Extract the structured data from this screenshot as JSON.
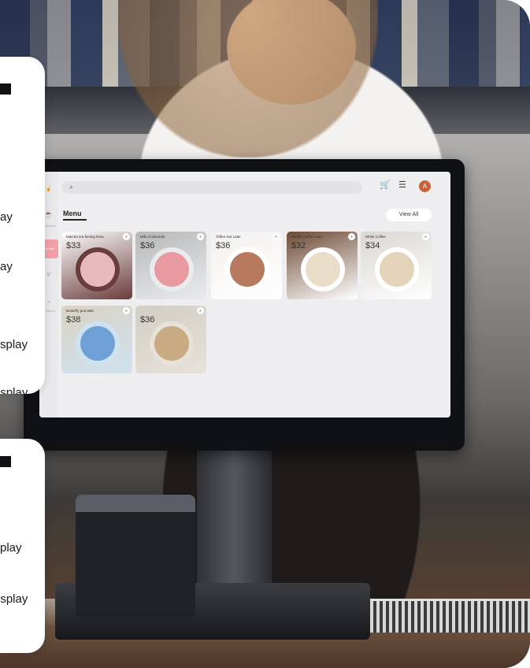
{
  "pos_app": {
    "search": {
      "placeholder": ""
    },
    "menu_title": "Menu",
    "view_all_label": "View All",
    "avatar_initial": "A",
    "sidebar": {
      "items": [
        {
          "label": "Dessert",
          "icon": "ice-cream-icon"
        },
        {
          "label": "Drinks",
          "icon": "cup-icon",
          "active": true
        },
        {
          "label": "",
          "icon": "leaf-icon"
        },
        {
          "label": "Others",
          "icon": "bowl-icon"
        }
      ]
    },
    "products": [
      {
        "name": "Matcha tea feeling brew",
        "price": "$33",
        "colors": [
          "#ffffff",
          "#6a3c3c",
          "#e7b9bd"
        ]
      },
      {
        "name": "Milk of almonds",
        "price": "$36",
        "colors": [
          "#b7b7b7",
          "#e9ecef",
          "#e89aa0"
        ]
      },
      {
        "name": "Toffee Nut Latte",
        "price": "$36",
        "colors": [
          "#f3f1ef",
          "#ffffff",
          "#b77a5f"
        ]
      },
      {
        "name": "Vanilla Coffee Latte",
        "price": "$32",
        "colors": [
          "#6d4a34",
          "#ffffff",
          "#e9dcc8"
        ]
      },
      {
        "name": "White Coffee",
        "price": "$34",
        "colors": [
          "#dad7d1",
          "#ffffff",
          "#e3d3b8"
        ]
      },
      {
        "name": "Butterfly pea latte",
        "price": "$38",
        "colors": [
          "#d9d2c2",
          "#cfe2f0",
          "#6fa1d6"
        ]
      },
      {
        "name": "",
        "price": "$36",
        "colors": [
          "#d2cec6",
          "#e6e2da",
          "#c9ab83"
        ]
      }
    ],
    "cart_icon": "cart-icon",
    "filter_icon": "filter-icon"
  },
  "overlay_panels": [
    {
      "rows": [
        "ay",
        "ay",
        "splay",
        "isplay"
      ]
    },
    {
      "rows": [
        "play",
        "isplay"
      ]
    }
  ]
}
